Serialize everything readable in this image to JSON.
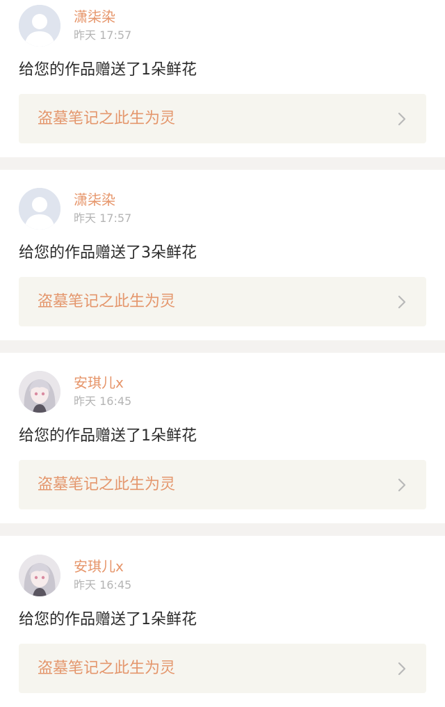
{
  "notifications": [
    {
      "user": "潇柒染",
      "time": "昨天 17:57",
      "avatar": "default-avatar",
      "message": "给您的作品赠送了1朵鲜花",
      "work_title": "盗墓笔记之此生为灵"
    },
    {
      "user": "潇柒染",
      "time": "昨天 17:57",
      "avatar": "default-avatar",
      "message": "给您的作品赠送了3朵鲜花",
      "work_title": "盗墓笔记之此生为灵"
    },
    {
      "user": "安琪儿x",
      "time": "昨天 16:45",
      "avatar": "anime-girl-avatar",
      "message": "给您的作品赠送了1朵鲜花",
      "work_title": "盗墓笔记之此生为灵"
    },
    {
      "user": "安琪儿x",
      "time": "昨天 16:45",
      "avatar": "anime-girl-avatar",
      "message": "给您的作品赠送了1朵鲜花",
      "work_title": "盗墓笔记之此生为灵"
    }
  ],
  "icons": {
    "chevron": "chevron-right-icon"
  },
  "colors": {
    "username": "#e6956a",
    "work_title": "#e4966c",
    "timestamp": "#b4b4b4",
    "message": "#2b2b2b",
    "link_background": "#f6f5ef",
    "separator": "#f4f2f0"
  }
}
